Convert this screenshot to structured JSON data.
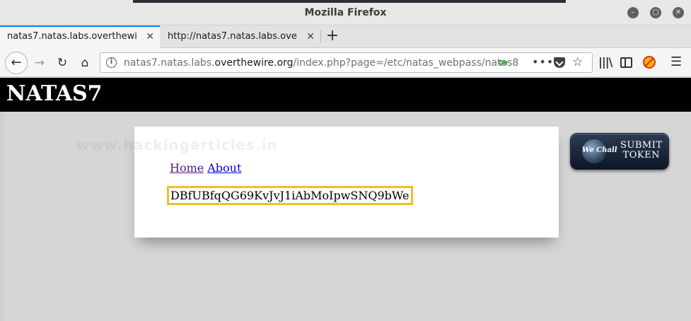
{
  "window": {
    "title": "Mozilla Firefox"
  },
  "tabs": [
    {
      "label": "natas7.natas.labs.overthewi",
      "active": true
    },
    {
      "label": "http://natas7.natas.labs.ove",
      "active": false
    }
  ],
  "urlbar": {
    "prefix": "natas7.natas.labs.",
    "domain": "overthewire.org",
    "path": "/index.php?page=/etc/natas_webpass/natas8"
  },
  "page": {
    "header_title": "NATAS7",
    "watermark": "www.hackingarticles.in",
    "menu": {
      "home": "Home",
      "about": "About"
    },
    "password": "DBfUBfqQG69KvJvJ1iAbMoIpwSNQ9bWe",
    "badge": {
      "logo": "We Chall",
      "line1": "SUBMIT",
      "line2": "TOKEN"
    }
  },
  "colors": {
    "header_bg": "#000000",
    "highlight_border": "#f3bd25",
    "tab_accent": "#0a84ff"
  }
}
